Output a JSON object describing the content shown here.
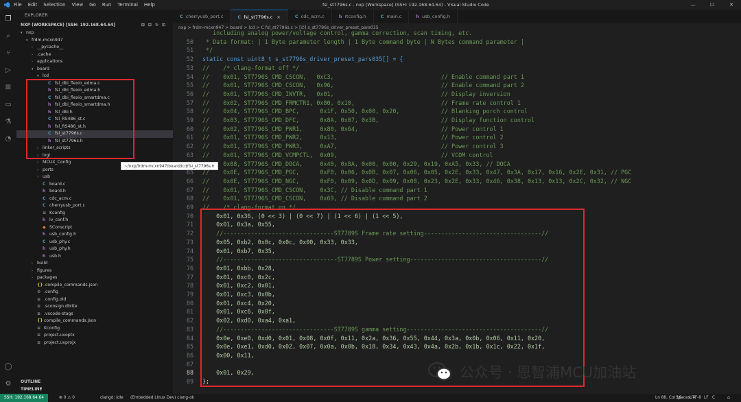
{
  "titlebar": {
    "menu": [
      "File",
      "Edit",
      "Selection",
      "View",
      "Go",
      "Run",
      "Terminal",
      "Help"
    ],
    "title": "fsl_st7796s.c - nxp [Workspace] (SSH: 192.168.64.64) - Visual Studio Code",
    "controls": [
      "—",
      "☐",
      "✕"
    ]
  },
  "activity_icons": [
    "files-icon",
    "search-icon",
    "source-control-icon",
    "run-debug-icon",
    "extensions-icon",
    "remote-explorer-icon",
    "testing-icon",
    "git-graph-icon",
    "account-icon",
    "settings-icon"
  ],
  "sidebar": {
    "header": "EXPLORER",
    "section": "NXP (WORKSPACE) [SSH: 192.168.64.64]",
    "rows": [
      {
        "indent": 0,
        "arrow": "▾",
        "label": "nxp",
        "icon": "",
        "type": "folder"
      },
      {
        "indent": 1,
        "arrow": "▾",
        "label": "frdm-mcxn947",
        "icon": "",
        "type": "folder"
      },
      {
        "indent": 2,
        "arrow": "›",
        "label": "__pycache__",
        "icon": "",
        "type": "folder"
      },
      {
        "indent": 2,
        "arrow": "›",
        "label": ".cache",
        "icon": "",
        "type": "folder"
      },
      {
        "indent": 2,
        "arrow": "›",
        "label": "applications",
        "icon": "",
        "type": "folder"
      },
      {
        "indent": 2,
        "arrow": "▾",
        "label": "board",
        "icon": "",
        "type": "folder"
      },
      {
        "indent": 3,
        "arrow": "▾",
        "label": "lcd",
        "icon": "",
        "type": "folder"
      },
      {
        "indent": 4,
        "arrow": "",
        "label": "fsl_dbi_flexio_edma.c",
        "icon": "C",
        "type": "c"
      },
      {
        "indent": 4,
        "arrow": "",
        "label": "fsl_dbi_flexio_edma.h",
        "icon": "h",
        "type": "h"
      },
      {
        "indent": 4,
        "arrow": "",
        "label": "fsl_dbi_flexio_smartdma.c",
        "icon": "C",
        "type": "c"
      },
      {
        "indent": 4,
        "arrow": "",
        "label": "fsl_dbi_flexio_smartdma.h",
        "icon": "h",
        "type": "h"
      },
      {
        "indent": 4,
        "arrow": "",
        "label": "fsl_dbi.h",
        "icon": "h",
        "type": "h"
      },
      {
        "indent": 4,
        "arrow": "",
        "label": "fsl_RS486_st.c",
        "icon": "C",
        "type": "c"
      },
      {
        "indent": 4,
        "arrow": "",
        "label": "fsl_RS486_st.h",
        "icon": "h",
        "type": "h"
      },
      {
        "indent": 4,
        "arrow": "",
        "label": "fsl_st7796s.c",
        "icon": "C",
        "type": "c"
      },
      {
        "indent": 4,
        "arrow": "",
        "label": "fsl_st7796s.h",
        "icon": "h",
        "type": "h"
      },
      {
        "indent": 3,
        "arrow": "›",
        "label": "linker_scripts",
        "icon": "",
        "type": "folder"
      },
      {
        "indent": 3,
        "arrow": "›",
        "label": "lvgl",
        "icon": "",
        "type": "folder"
      },
      {
        "indent": 3,
        "arrow": "›",
        "label": "MCUX_Config",
        "icon": "",
        "type": "folder"
      },
      {
        "indent": 3,
        "arrow": "›",
        "label": "ports",
        "icon": "",
        "type": "folder"
      },
      {
        "indent": 3,
        "arrow": "›",
        "label": "usb",
        "icon": "",
        "type": "folder"
      },
      {
        "indent": 3,
        "arrow": "",
        "label": "board.c",
        "icon": "C",
        "type": "c"
      },
      {
        "indent": 3,
        "arrow": "",
        "label": "board.h",
        "icon": "h",
        "type": "h"
      },
      {
        "indent": 3,
        "arrow": "",
        "label": "cdc_acm.c",
        "icon": "C",
        "type": "c"
      },
      {
        "indent": 3,
        "arrow": "",
        "label": "cherryusb_port.c",
        "icon": "C",
        "type": "c"
      },
      {
        "indent": 3,
        "arrow": "",
        "label": "Kconfig",
        "icon": "≡",
        "type": "cfg"
      },
      {
        "indent": 3,
        "arrow": "",
        "label": "lv_conf.h",
        "icon": "h",
        "type": "h"
      },
      {
        "indent": 3,
        "arrow": "",
        "label": "SConscript",
        "icon": "◆",
        "type": "py"
      },
      {
        "indent": 3,
        "arrow": "",
        "label": "usb_config.h",
        "icon": "h",
        "type": "h"
      },
      {
        "indent": 3,
        "arrow": "",
        "label": "usb_phy.c",
        "icon": "C",
        "type": "c"
      },
      {
        "indent": 3,
        "arrow": "",
        "label": "usb_phy.h",
        "icon": "h",
        "type": "h"
      },
      {
        "indent": 3,
        "arrow": "",
        "label": "usb.h",
        "icon": "h",
        "type": "h"
      },
      {
        "indent": 2,
        "arrow": "›",
        "label": "build",
        "icon": "",
        "type": "folder"
      },
      {
        "indent": 2,
        "arrow": "›",
        "label": "figures",
        "icon": "",
        "type": "folder"
      },
      {
        "indent": 2,
        "arrow": "›",
        "label": "packages",
        "icon": "",
        "type": "folder"
      },
      {
        "indent": 2,
        "arrow": "",
        "label": ".compile_commands.json",
        "icon": "{}",
        "type": "json"
      },
      {
        "indent": 2,
        "arrow": "",
        "label": ".config",
        "icon": "⚙",
        "type": "cfg"
      },
      {
        "indent": 2,
        "arrow": "",
        "label": ".config.old",
        "icon": "≡",
        "type": "cfg"
      },
      {
        "indent": 2,
        "arrow": "",
        "label": ".sconsign.dblite",
        "icon": "≡",
        "type": "cfg"
      },
      {
        "indent": 2,
        "arrow": "",
        "label": ".vscode-stags",
        "icon": "≡",
        "type": "cfg"
      },
      {
        "indent": 2,
        "arrow": "",
        "label": "compile_commands.json",
        "icon": "{}",
        "type": "json"
      },
      {
        "indent": 2,
        "arrow": "",
        "label": "Kconfig",
        "icon": "≡",
        "type": "cfg"
      },
      {
        "indent": 2,
        "arrow": "",
        "label": "project.uvoptx",
        "icon": "≡",
        "type": "cfg"
      },
      {
        "indent": 2,
        "arrow": "",
        "label": "project.uvprojx",
        "icon": "≡",
        "type": "cfg"
      }
    ],
    "selected": "fsl_st7796s.c",
    "tooltip": "~/nxp/frdm-mcxn947/board/lcd/fsl_st7796s.h",
    "outline": "OUTLINE",
    "timeline": "TIMELINE"
  },
  "tabs": [
    {
      "icon": "C",
      "label": "cherryusb_port.c",
      "active": false
    },
    {
      "icon": "C",
      "label": "fsl_st7796s.c",
      "active": true
    },
    {
      "icon": "C",
      "label": "cdc_acm.c",
      "active": false
    },
    {
      "icon": "h",
      "label": "rtconfig.h",
      "active": false
    },
    {
      "icon": "C",
      "label": "main.c",
      "active": false
    },
    {
      "icon": "h",
      "label": "usb_config.h",
      "active": false
    }
  ],
  "breadcrumb": "nxp > frdm-mcxn947 > board > lcd > C fsl_st7796s.c > [∅] s_st7796s_driver_preset_pars035",
  "code": [
    {
      "n": "",
      "t": "   including analog power/voltage control, gamma correction, scan timing, etc."
    },
    {
      "n": "50",
      "t": " * Data format: | 1 Byte parameter length | 1 Byte command byte | N Bytes command parameter |"
    },
    {
      "n": "51",
      "t": " */"
    },
    {
      "n": "52",
      "t": "static const uint8_t s_st7796s_driver_preset_pars035[] = {"
    },
    {
      "n": "53",
      "t": "//    /* clang-format off */"
    },
    {
      "n": "54",
      "t": "//    0x01, ST7796S_CMD_CSCON,   0xC3,                               // Enable command part 1"
    },
    {
      "n": "55",
      "t": "//    0x01, ST7796S_CMD_CSCON,   0x96,                               // Enable command part 2"
    },
    {
      "n": "56",
      "t": "//    0x01, ST7796S_CMD_INVTR,   0x01,                               // Display inversion"
    },
    {
      "n": "57",
      "t": "//    0x02, ST7796S_CMD_FRMCTR1, 0x80, 0x10,                         // Frame rate control 1"
    },
    {
      "n": "58",
      "t": "//    0x04, ST7796S_CMD_BPC,      0x1F, 0x50, 0x00, 0x20,            // Blanking porch control"
    },
    {
      "n": "59",
      "t": "//    0x03, ST7796S_CMD_DFC,      0x8A, 0x07, 0x3B,                  // Display function control"
    },
    {
      "n": "60",
      "t": "//    0x02, ST7796S_CMD_PWR1,     0x80, 0x64,                        // Power control 1"
    },
    {
      "n": "61",
      "t": "//    0x01, ST7796S_CMD_PWR2,     0x13,                              // Power control 2"
    },
    {
      "n": "62",
      "t": "//    0x01, ST7796S_CMD_PWR3,     0xA7,                              // Power control 3"
    },
    {
      "n": "63",
      "t": "//    0x01, ST7796S_CMD_VCMPCTL,  0x09,                              // VCOM control"
    },
    {
      "n": "64",
      "t": "//    0x08, ST7796S_CMD_DOCA,     0x40, 0x8A, 0x00, 0x00, 0x29, 0x19, 0xA5, 0x33, // DOCA"
    },
    {
      "n": "65",
      "t": "//    0x0E, ST7796S_CMD_PGC,      0xF0, 0x06, 0x0B, 0x07, 0x06, 0x05, 0x2E, 0x33, 0x47, 0x3A, 0x17, 0x16, 0x2E, 0x31, // PGC"
    },
    {
      "n": "66",
      "t": "//    0x0E, ST7796S_CMD_NGC,      0xF0, 0x09, 0x0D, 0x09, 0x08, 0x23, 0x2E, 0x33, 0x46, 0x38, 0x13, 0x13, 0x2C, 0x32, // NGC"
    },
    {
      "n": "67",
      "t": "//    0x01, ST7796S_CMD_CSCON,    0x3C, // Disable command part 1"
    },
    {
      "n": "68",
      "t": "//    0x01, ST7796S_CMD_CSCON,    0x69, // Disable command part 2"
    },
    {
      "n": "69",
      "t": "//    /* clang-format on */"
    },
    {
      "n": "70",
      "t": "    0x01, 0x36, (0 << 3) | (0 << 7) | (1 << 6) | (1 << 5),"
    },
    {
      "n": "71",
      "t": "    0x01, 0x3a, 0x55,"
    },
    {
      "n": "72",
      "t": "    //--------------------------------ST7789S Frame rate setting----------------------------------//"
    },
    {
      "n": "73",
      "t": "    0x05, 0xb2, 0x0c, 0x0c, 0x00, 0x33, 0x33,"
    },
    {
      "n": "74",
      "t": "    0x01, 0xb7, 0x35,"
    },
    {
      "n": "75",
      "t": "    //---------------------------------ST7789S Power setting--------------------------------------//"
    },
    {
      "n": "76",
      "t": "    0x01, 0xbb, 0x28,"
    },
    {
      "n": "77",
      "t": "    0x01, 0xc0, 0x2c,"
    },
    {
      "n": "78",
      "t": "    0x01, 0xc2, 0x01,"
    },
    {
      "n": "79",
      "t": "    0x01, 0xc3, 0x0b,"
    },
    {
      "n": "80",
      "t": "    0x01, 0xc4, 0x20,"
    },
    {
      "n": "81",
      "t": "    0x01, 0xc6, 0x0f,"
    },
    {
      "n": "82",
      "t": "    0x02, 0xd0, 0xa4, 0xa1,"
    },
    {
      "n": "83",
      "t": "    //--------------------------------ST7789S gamma setting---------------------------------------//"
    },
    {
      "n": "84",
      "t": "    0x0e, 0xe0, 0xd0, 0x01, 0x08, 0x0f, 0x11, 0x2a, 0x36, 0x55, 0x44, 0x3a, 0x0b, 0x06, 0x11, 0x20,"
    },
    {
      "n": "85",
      "t": "    0x0e, 0xe1, 0xd0, 0x02, 0x07, 0x0a, 0x0b, 0x18, 0x34, 0x43, 0x4a, 0x2b, 0x1b, 0x1c, 0x22, 0x1f,"
    },
    {
      "n": "86",
      "t": "    0x00, 0x11,"
    },
    {
      "n": "87",
      "t": ""
    },
    {
      "n": "88",
      "t": "    0x01, 0x29,"
    },
    {
      "n": "89",
      "t": "};"
    }
  ],
  "status": {
    "remote": "SSH: 192.168.64.64",
    "items": [
      "⊗ 0 ⚠ 0",
      "clangd: idle",
      "(Embedded Linux Dev) clang-ok"
    ],
    "right": [
      "Ln 88, Col 16",
      "Spaces: 4",
      "UTF-8",
      "LF",
      "C",
      "⌂"
    ]
  },
  "watermark": "公众号 · 恩智浦MCU加油站",
  "colors": {
    "accent": "#0078d4",
    "highlight_box": "#e0282e",
    "remote": "#16825d"
  }
}
